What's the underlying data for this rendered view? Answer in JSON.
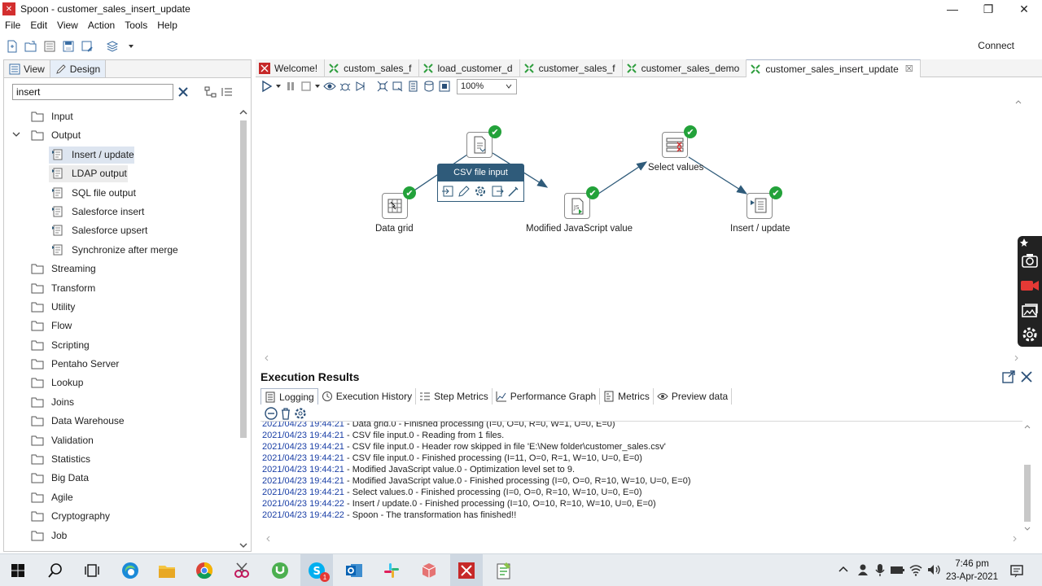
{
  "window": {
    "logo_text": "✕",
    "title": "Spoon - customer_sales_insert_update",
    "controls": [
      "—",
      "❐",
      "✕"
    ]
  },
  "menu": [
    "File",
    "Edit",
    "View",
    "Action",
    "Tools",
    "Help"
  ],
  "toolbar": {
    "connect_label": "Connect"
  },
  "left_panel": {
    "tabs": [
      "View",
      "Design"
    ],
    "search": {
      "value": "insert"
    },
    "tree": [
      {
        "label": "Input",
        "type": "folder",
        "expanded": false
      },
      {
        "label": "Output",
        "type": "folder",
        "expanded": true
      },
      {
        "label": "Insert / update",
        "type": "child",
        "selected": true
      },
      {
        "label": "LDAP output",
        "type": "child"
      },
      {
        "label": "SQL file output",
        "type": "child"
      },
      {
        "label": "Salesforce insert",
        "type": "child"
      },
      {
        "label": "Salesforce upsert",
        "type": "child"
      },
      {
        "label": "Synchronize after merge",
        "type": "child"
      },
      {
        "label": "Streaming",
        "type": "folder"
      },
      {
        "label": "Transform",
        "type": "folder"
      },
      {
        "label": "Utility",
        "type": "folder"
      },
      {
        "label": "Flow",
        "type": "folder"
      },
      {
        "label": "Scripting",
        "type": "folder"
      },
      {
        "label": "Pentaho Server",
        "type": "folder"
      },
      {
        "label": "Lookup",
        "type": "folder"
      },
      {
        "label": "Joins",
        "type": "folder"
      },
      {
        "label": "Data Warehouse",
        "type": "folder"
      },
      {
        "label": "Validation",
        "type": "folder"
      },
      {
        "label": "Statistics",
        "type": "folder"
      },
      {
        "label": "Big Data",
        "type": "folder"
      },
      {
        "label": "Agile",
        "type": "folder"
      },
      {
        "label": "Cryptography",
        "type": "folder"
      },
      {
        "label": "Job",
        "type": "folder"
      }
    ]
  },
  "doc_tabs": [
    {
      "label": "Welcome!",
      "icon": "spoon-icon",
      "active": false
    },
    {
      "label": "custom_sales_f",
      "icon": "transformation-icon",
      "active": false
    },
    {
      "label": "load_customer_d",
      "icon": "transformation-icon",
      "active": false
    },
    {
      "label": "customer_sales_f",
      "icon": "transformation-icon",
      "active": false
    },
    {
      "label": "customer_sales_demo",
      "icon": "transformation-icon",
      "active": false
    },
    {
      "label": "customer_sales_insert_update",
      "icon": "transformation-icon",
      "active": true,
      "close": "☒"
    }
  ],
  "canvas_toolbar": {
    "zoom": "100%"
  },
  "canvas": {
    "steps": [
      {
        "label": "Data grid",
        "status": "✔"
      },
      {
        "label": "CSV file input",
        "status": "✔"
      },
      {
        "label": "Modified JavaScript value",
        "status": "✔"
      },
      {
        "label": "Select values",
        "status": "✔"
      },
      {
        "label": "Insert / update",
        "status": "✔"
      }
    ],
    "tooltip_title": "CSV file input"
  },
  "execution": {
    "title": "Execution Results",
    "tabs": [
      "Logging",
      "Execution History",
      "Step Metrics",
      "Performance Graph",
      "Metrics",
      "Preview data"
    ],
    "log": [
      {
        "ts": "2021/04/23 19:44:21",
        "msg": " - Data grid.0 - Finished processing (I=0, O=0, R=0, W=1, U=0, E=0)"
      },
      {
        "ts": "2021/04/23 19:44:21",
        "msg": " - CSV file input.0 - Reading from 1 files."
      },
      {
        "ts": "2021/04/23 19:44:21",
        "msg": " - CSV file input.0 - Header row skipped in file 'E:\\New folder\\customer_sales.csv'"
      },
      {
        "ts": "2021/04/23 19:44:21",
        "msg": " - CSV file input.0 - Finished processing (I=11, O=0, R=1, W=10, U=0, E=0)"
      },
      {
        "ts": "2021/04/23 19:44:21",
        "msg": " - Modified JavaScript value.0 - Optimization level set to 9."
      },
      {
        "ts": "2021/04/23 19:44:21",
        "msg": " - Modified JavaScript value.0 - Finished processing (I=0, O=0, R=10, W=10, U=0, E=0)"
      },
      {
        "ts": "2021/04/23 19:44:21",
        "msg": " - Select values.0 - Finished processing (I=0, O=0, R=10, W=10, U=0, E=0)"
      },
      {
        "ts": "2021/04/23 19:44:22",
        "msg": " - Insert / update.0 - Finished processing (I=10, O=10, R=10, W=10, U=0, E=0)"
      },
      {
        "ts": "2021/04/23 19:44:22",
        "msg": " - Spoon - The transformation has finished!!"
      }
    ]
  },
  "taskbar": {
    "clock_time": "7:46 pm",
    "clock_date": "23-Apr-2021",
    "skype_badge": "1"
  },
  "colors": {
    "accent": "#2f5b7a",
    "ok": "#23a23a",
    "log_timestamp": "#1a3fa6",
    "brand_red": "#d32f2f"
  }
}
